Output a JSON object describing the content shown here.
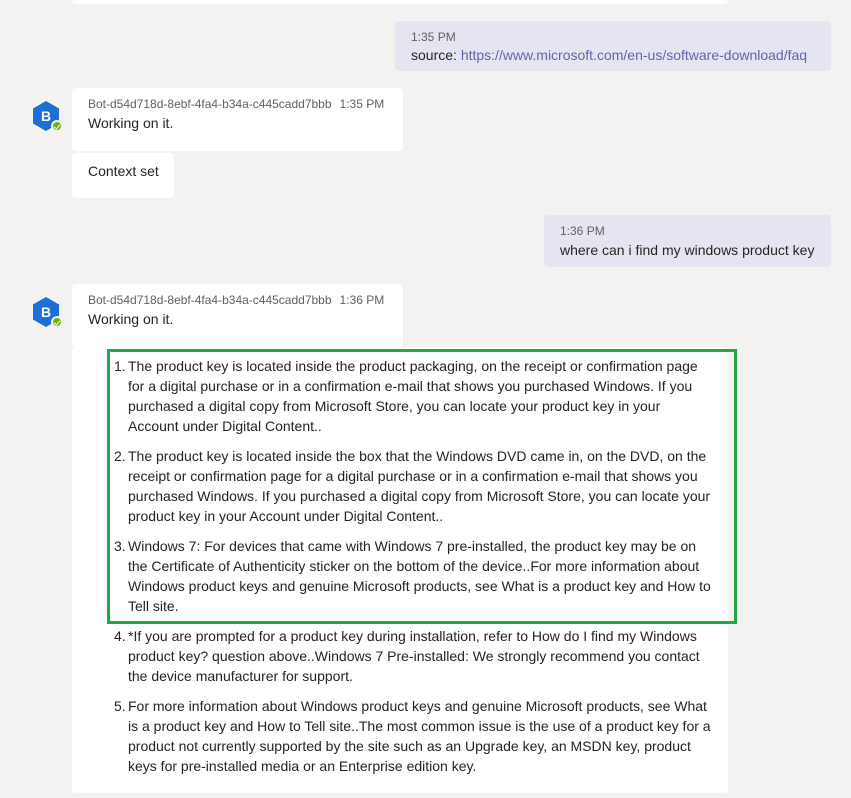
{
  "colors": {
    "background": "#f3f2f1",
    "my_bubble": "#e5e5f1",
    "link": "#6264a7",
    "avatar": "#1b6fd6",
    "online": "#6bb700",
    "highlight": "#21a84a"
  },
  "messages": [
    {
      "from": "me",
      "time": "1:35 PM",
      "text_prefix": "source: ",
      "link": "https://www.microsoft.com/en-us/software-download/faq"
    },
    {
      "from": "bot",
      "avatar_letter": "B",
      "name": "Bot-d54d718d-8ebf-4fa4-b34a-c445cadd7bbb",
      "time": "1:35 PM",
      "text": "Working on it.",
      "followup": "Context set"
    },
    {
      "from": "me",
      "time": "1:36 PM",
      "text": "where can i find my windows product key"
    },
    {
      "from": "bot",
      "avatar_letter": "B",
      "name": "Bot-d54d718d-8ebf-4fa4-b34a-c445cadd7bbb",
      "time": "1:36 PM",
      "text": "Working on it."
    }
  ],
  "answers": [
    {
      "num": "1.",
      "lines": [
        "The product key is located inside the product packaging, on the receipt or confirmation page",
        "for a digital purchase or in a confirmation e-mail that shows you purchased Windows. If you",
        "purchased a digital copy from Microsoft Store, you can locate your product key in your",
        "Account under Digital Content.."
      ]
    },
    {
      "num": "2.",
      "lines": [
        "The product key is located inside the box that the Windows DVD came in, on the DVD, on the",
        "receipt or confirmation page for a digital purchase or in a confirmation e-mail that shows you",
        "purchased Windows. If you purchased a digital copy from Microsoft Store, you can locate your",
        "product key in your Account under Digital Content.."
      ]
    },
    {
      "num": "3.",
      "lines": [
        "Windows 7: For devices that came with Windows 7 pre-installed, the product key may be on",
        "the Certificate of Authenticity sticker on the bottom of the device..For more information about",
        "Windows product keys and genuine Microsoft products, see What is a product key and How to",
        "Tell site."
      ]
    },
    {
      "num": "4.",
      "lines": [
        "*If you are prompted for a product key during installation, refer to How do I find my Windows",
        "product key? question above..Windows 7 Pre-installed: We strongly recommend you contact",
        "the device manufacturer for support."
      ]
    },
    {
      "num": "5.",
      "lines": [
        "For more information about Windows product keys and genuine Microsoft products, see What",
        "is a product key and How to Tell site..The most common issue is the use of a product key for a",
        "product not currently supported by the site such as an Upgrade key, an MSDN key, product",
        "keys for pre-installed media or an Enterprise edition key."
      ]
    }
  ]
}
